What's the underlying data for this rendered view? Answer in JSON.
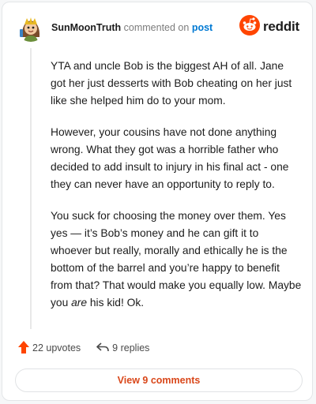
{
  "header": {
    "username": "SunMoonTruth",
    "action_text": "commented on",
    "post_link": "post",
    "brand": "reddit",
    "avatar_icon": "snoo-avatar-icon",
    "logo_icon": "reddit-snoo-icon",
    "brand_color": "#ff4500"
  },
  "comment": {
    "paragraphs": [
      {
        "text": "YTA and uncle Bob is the biggest AH of all. Jane got her just desserts with Bob cheating on her just like she helped him do to your mom."
      },
      {
        "text": "However, your cousins have not done anything wrong. What they got was a horrible father who decided to add insult to injury in his final act - one they can never have an opportunity to reply to."
      },
      {
        "before": "You suck for choosing the money over them. Yes yes — it’s Bob’s money and he can gift it to whoever but really, morally and ethically he is the bottom of the barrel and you’re happy to benefit from that? That would make you equally low. Maybe you ",
        "emphasis": "are",
        "after": " his kid! Ok."
      }
    ]
  },
  "actions": {
    "upvotes": "22 upvotes",
    "replies": "9 replies",
    "upvote_icon": "upvote-arrow-icon",
    "reply_icon": "reply-arrow-icon",
    "upvote_color": "#ff4500"
  },
  "footer": {
    "view_comments": "View 9 comments",
    "accent_color": "#d9471a"
  }
}
